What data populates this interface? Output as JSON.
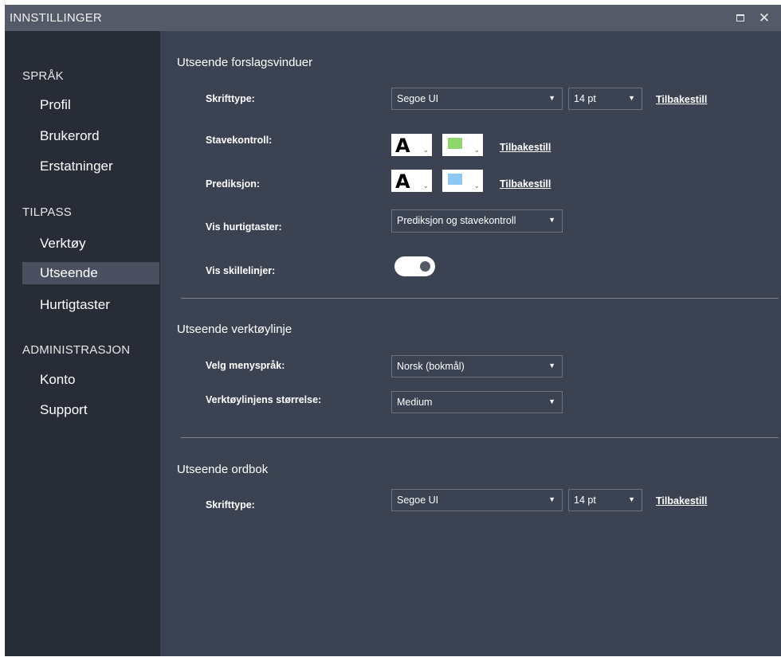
{
  "window": {
    "title": "INNSTILLINGER"
  },
  "sidebar": {
    "sections": [
      {
        "title": "SPRÅK",
        "items": [
          "Profil",
          "Brukerord",
          "Erstatninger"
        ]
      },
      {
        "title": "TILPASS",
        "items": [
          "Verktøy",
          "Utseende",
          "Hurtigtaster"
        ]
      },
      {
        "title": "ADMINISTRASJON",
        "items": [
          "Konto",
          "Support"
        ]
      }
    ],
    "active_item": "Utseende"
  },
  "main": {
    "suggestions": {
      "title": "Utseende forslagsvinduer",
      "font_label": "Skrifttype:",
      "font_value": "Segoe UI",
      "size_value": "14 pt",
      "reset_label": "Tilbakestill",
      "spell_label": "Stavekontroll:",
      "spell_letter": "A",
      "spell_color": "#8fd66a",
      "prediction_label": "Prediksjon:",
      "prediction_letter": "A",
      "prediction_color": "#8ec8f2",
      "shortcuts_label": "Vis hurtigtaster:",
      "shortcuts_value": "Prediksjon og stavekontroll",
      "dividers_label": "Vis skillelinjer:",
      "dividers_on": true
    },
    "toolbar": {
      "title": "Utseende verktøylinje",
      "language_label": "Velg menyspråk:",
      "language_value": "Norsk (bokmål)",
      "size_label": "Verktøylinjens størrelse:",
      "size_value": "Medium"
    },
    "dictionary": {
      "title": "Utseende ordbok",
      "font_label": "Skrifttype:",
      "font_value": "Segoe UI",
      "size_value": "14 pt",
      "reset_label": "Tilbakestill"
    }
  },
  "icons": {
    "maximize": "maximize-icon",
    "close": "close-icon",
    "dropdown": "caret-down-icon"
  }
}
